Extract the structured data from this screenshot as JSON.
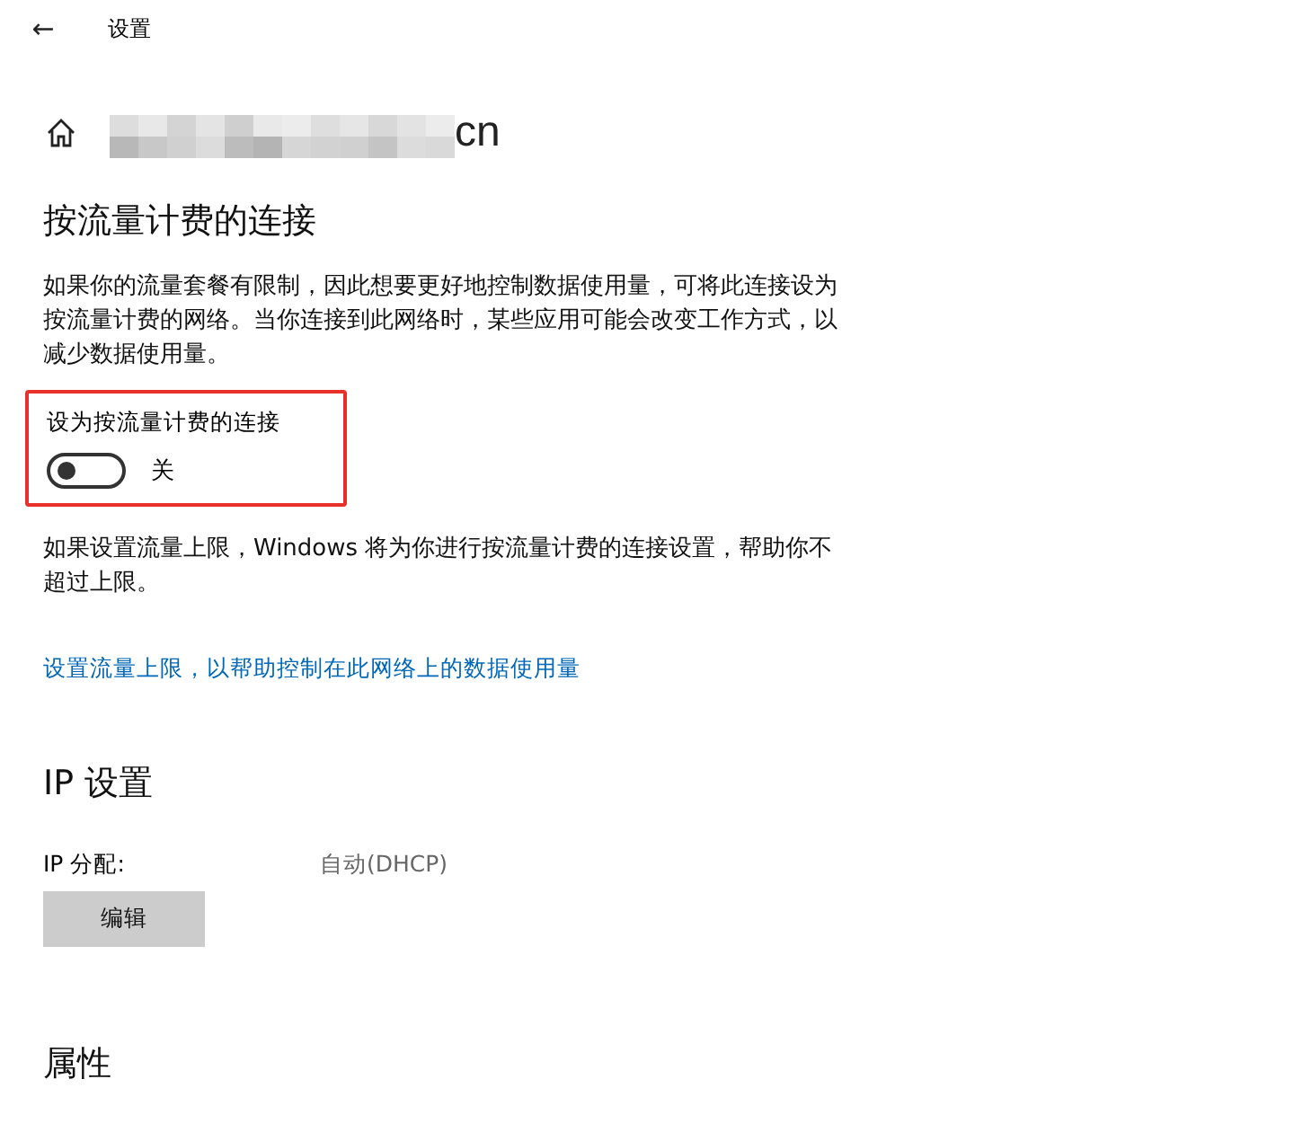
{
  "window": {
    "title": "设置",
    "back": "←"
  },
  "header": {
    "title_tail": "cn",
    "redacted": true
  },
  "metered": {
    "heading": "按流量计费的连接",
    "description": "如果你的流量套餐有限制，因此想要更好地控制数据使用量，可将此连接设为按流量计费的网络。当你连接到此网络时，某些应用可能会改变工作方式，以减少数据使用量。",
    "toggle": {
      "label": "设为按流量计费的连接",
      "on": false,
      "state_text": "关",
      "highlighted": true
    },
    "note": "如果设置流量上限，Windows 将为你进行按流量计费的连接设置，帮助你不超过上限。",
    "link": "设置流量上限，以帮助控制在此网络上的数据使用量"
  },
  "ip": {
    "heading": "IP 设置",
    "label": "IP 分配:",
    "value": "自动(DHCP)",
    "button": "编辑"
  },
  "properties": {
    "heading": "属性"
  }
}
